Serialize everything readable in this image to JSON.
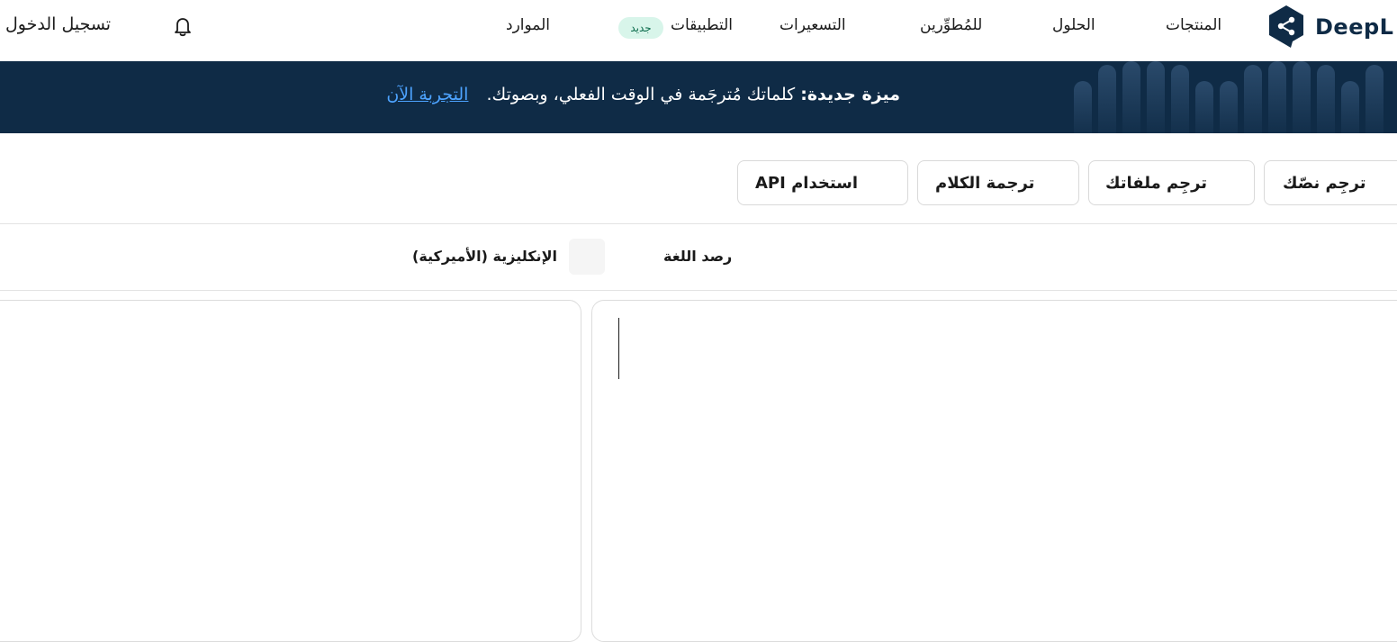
{
  "brand": {
    "name": "DeepL",
    "dark_color": "#0f2b46",
    "link_color": "#4da3ff"
  },
  "nav": {
    "products": "المنتجات",
    "solutions": "الحلول",
    "developers": "للمُطوِّرين",
    "pricing": "التسعيرات",
    "apps": "التطبيقات",
    "apps_badge": "جديد",
    "resources": "الموارد",
    "notifications_icon": "bell-icon",
    "login": "تسجيل الدخول"
  },
  "banner": {
    "label": "ميزة جديدة:",
    "message": "كلماتك مُترجَمة في الوقت الفعلي، وبصوتك.",
    "cta": "التجربة الآن"
  },
  "tabs": [
    {
      "label": "ترجِم نصّك"
    },
    {
      "label": "ترجِم ملفاتك"
    },
    {
      "label": "ترجمة الكلام"
    },
    {
      "label": "استخدام API"
    }
  ],
  "languages": {
    "source": "رصد اللغة",
    "swap_icon": "swap-icon",
    "target": "الإنكليزية (الأميركية)"
  },
  "editor": {
    "source_text": "",
    "target_text": ""
  }
}
